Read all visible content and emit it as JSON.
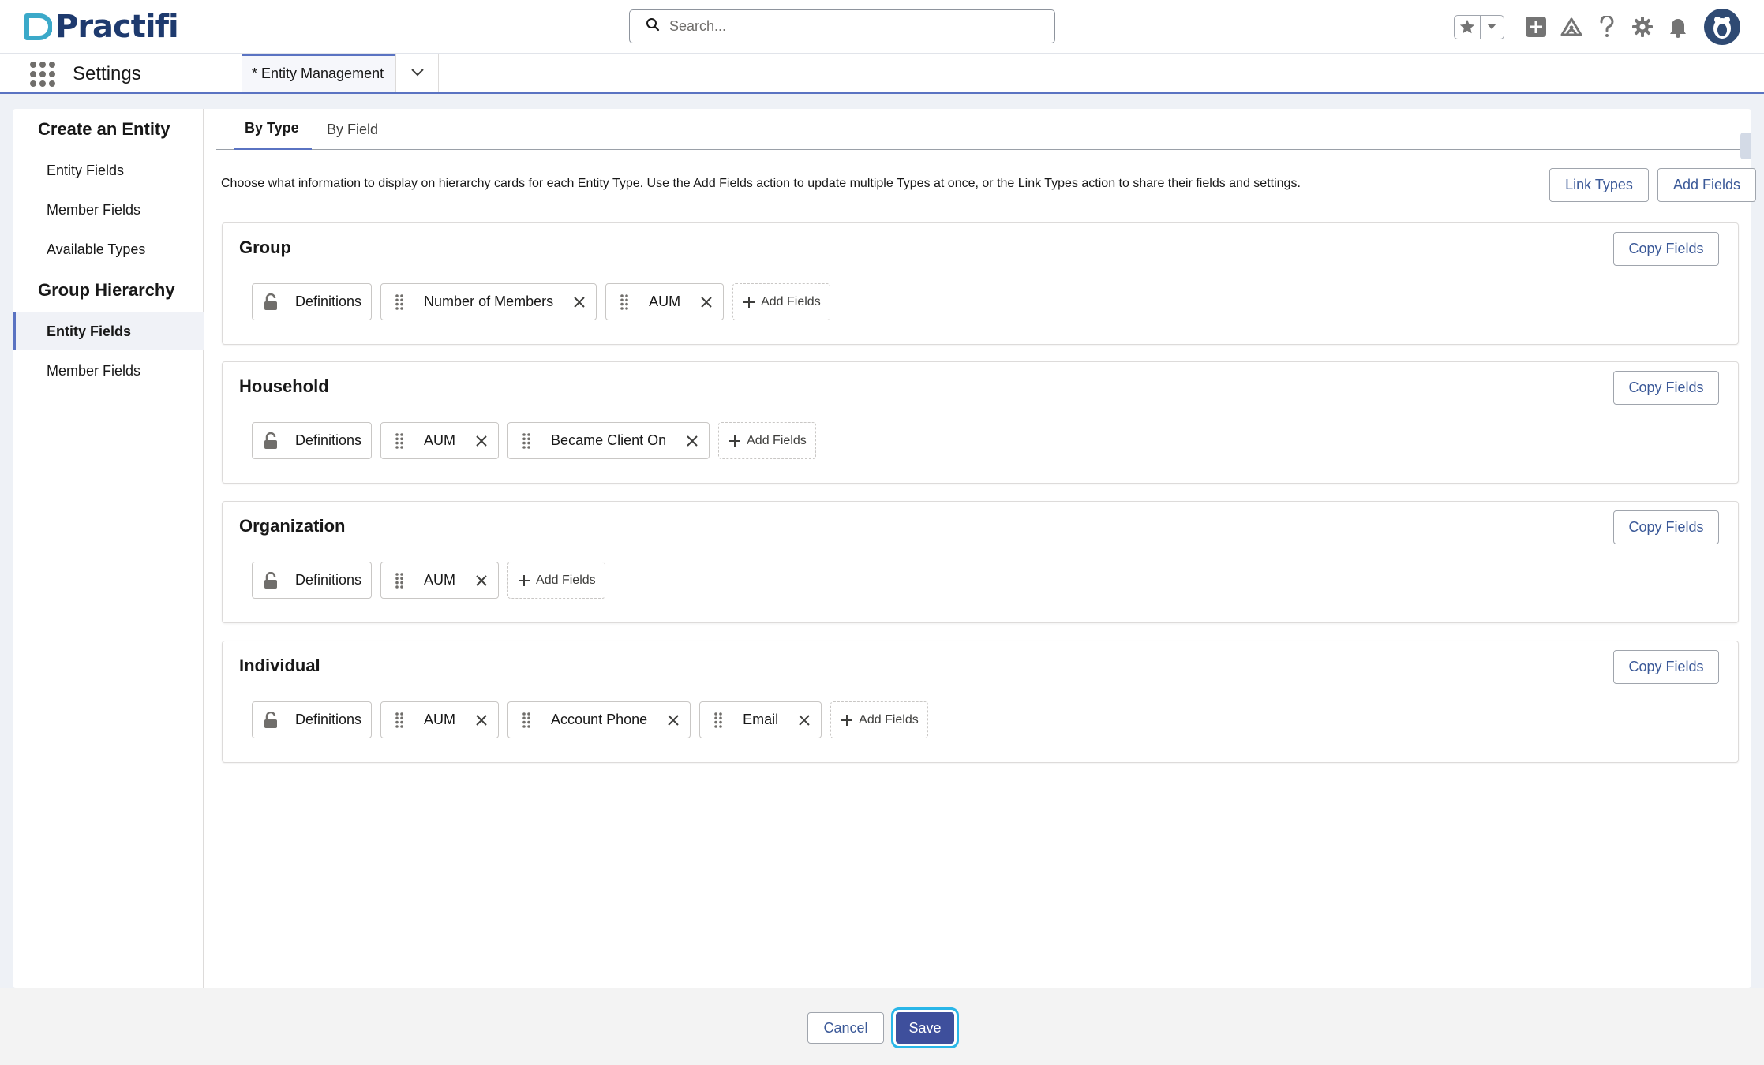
{
  "header": {
    "logo_text": "Practifi",
    "search_placeholder": "Search..."
  },
  "nav": {
    "app_name": "Settings",
    "tab_label": "* Entity Management"
  },
  "sidebar": {
    "sections": [
      {
        "title": "Create an Entity",
        "items": [
          "Entity Fields",
          "Member Fields",
          "Available Types"
        ]
      },
      {
        "title": "Group Hierarchy",
        "items": [
          "Entity Fields",
          "Member Fields"
        ]
      }
    ],
    "active_item": "Group Hierarchy / Entity Fields"
  },
  "tabs": [
    {
      "label": "By Type",
      "active": true
    },
    {
      "label": "By Field",
      "active": false
    }
  ],
  "description": "Choose what information to display on hierarchy cards for each Entity Type. Use the Add Fields action to update multiple Types at once, or the Link Types action to share their fields and settings.",
  "actions": {
    "link_types": "Link Types",
    "add_fields": "Add Fields"
  },
  "cards": [
    {
      "title": "Group",
      "copy_label": "Copy Fields",
      "locked_chip": "Definitions",
      "fields": [
        "Number of Members",
        "AUM"
      ],
      "add_label": "Add Fields"
    },
    {
      "title": "Household",
      "copy_label": "Copy Fields",
      "locked_chip": "Definitions",
      "fields": [
        "AUM",
        "Became Client On"
      ],
      "add_label": "Add Fields"
    },
    {
      "title": "Organization",
      "copy_label": "Copy Fields",
      "locked_chip": "Definitions",
      "fields": [
        "AUM"
      ],
      "add_label": "Add Fields"
    },
    {
      "title": "Individual",
      "copy_label": "Copy Fields",
      "locked_chip": "Definitions",
      "fields": [
        "AUM",
        "Account Phone",
        "Email"
      ],
      "add_label": "Add Fields"
    }
  ],
  "footer": {
    "cancel": "Cancel",
    "save": "Save"
  },
  "colors": {
    "brand_navy": "#1e3a6e",
    "accent_blue": "#5a73c2",
    "save_button": "#3e4f9c",
    "focus_ring": "#29b6e8",
    "link_text": "#3b5998"
  }
}
